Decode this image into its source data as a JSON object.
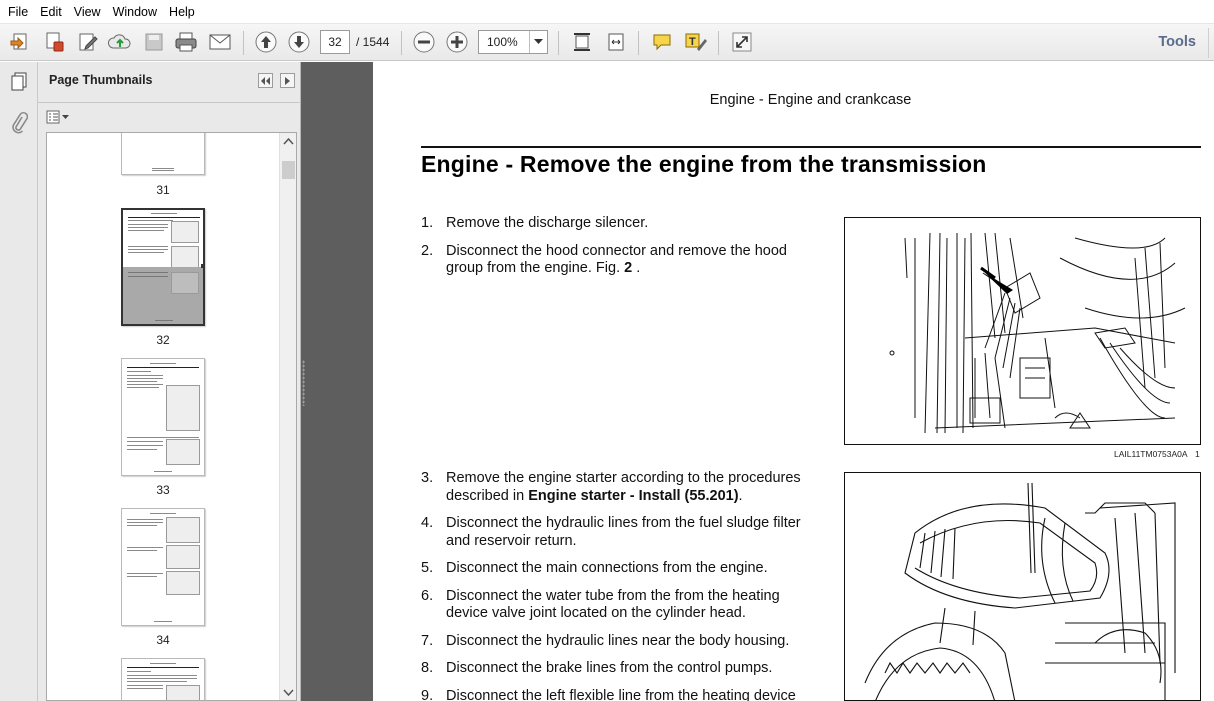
{
  "menu": [
    "File",
    "Edit",
    "View",
    "Window",
    "Help"
  ],
  "toolbar": {
    "page_current": "32",
    "page_total": "/  1544",
    "zoom": "100%",
    "tools_label": "Tools"
  },
  "thumbnails_panel": {
    "title": "Page Thumbnails",
    "pages": [
      "31",
      "32",
      "33",
      "34"
    ]
  },
  "document": {
    "running_header": "Engine - Engine and crankcase",
    "title": "Engine - Remove the engine from the transmission",
    "steps_a": [
      {
        "n": "1.",
        "text": "Remove the discharge silencer."
      },
      {
        "n": "2.",
        "text": "Disconnect the hood connector and remove the hood group from the engine.  Fig. ",
        "bold": "2",
        "after": " ."
      }
    ],
    "steps_b": [
      {
        "n": "3.",
        "text": "Remove the engine starter according to the procedures described in ",
        "bold": "Engine starter - Install (55.201)",
        "after": "."
      },
      {
        "n": "4.",
        "text": "Disconnect the hydraulic lines from the fuel sludge filter and reservoir return."
      },
      {
        "n": "5.",
        "text": "Disconnect the main connections from the engine."
      },
      {
        "n": "6.",
        "text": "Disconnect the water tube from the from the heating device valve joint located on the cylinder head."
      },
      {
        "n": "7.",
        "text": "Disconnect the hydraulic lines near the body housing."
      },
      {
        "n": "8.",
        "text": "Disconnect the brake lines from the control pumps."
      },
      {
        "n": "9.",
        "text": "Disconnect the left flexible line from the heating device"
      }
    ],
    "figure1": {
      "caption": "LAIL11TM0753A0A",
      "number": "1"
    }
  }
}
